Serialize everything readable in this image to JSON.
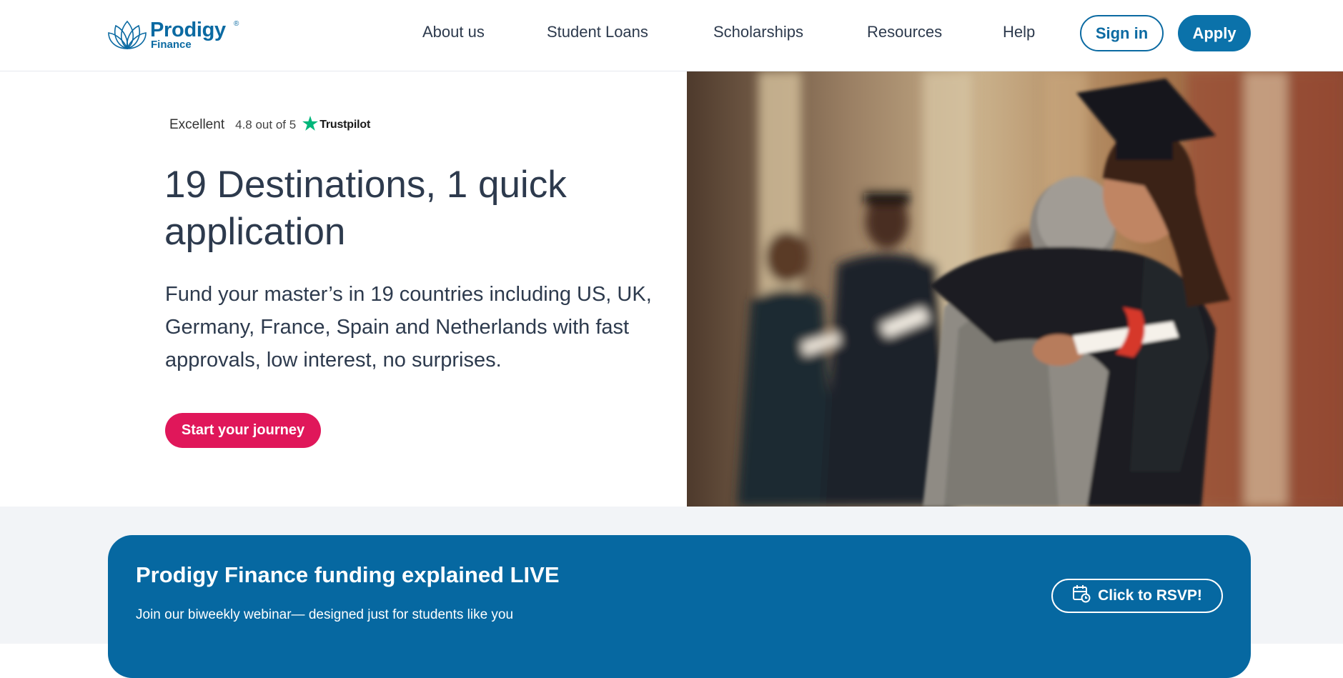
{
  "brand": {
    "name": "Prodigy",
    "registered": "®",
    "sub": "Finance",
    "primary_color": "#0b6aa2",
    "accent_color": "#e0175a"
  },
  "nav": {
    "items": [
      {
        "label": "About us"
      },
      {
        "label": "Student Loans"
      },
      {
        "label": "Scholarships"
      },
      {
        "label": "Resources"
      },
      {
        "label": "Help"
      }
    ],
    "signin_label": "Sign in",
    "apply_label": "Apply"
  },
  "rating": {
    "label": "Excellent",
    "score": "4.8 out of 5",
    "provider": "Trustpilot",
    "icon": "trustpilot-star-icon",
    "icon_color": "#00b67a"
  },
  "hero": {
    "title": "19 Destinations, 1 quick application",
    "text": "Fund your master’s in 19 countries including US, UK, Germany, France, Spain and Netherlands with fast approvals, low interest, no surprises.",
    "cta_label": "Start your journey",
    "image": "graduation-hug-photo"
  },
  "webinar": {
    "title": "Prodigy Finance funding explained LIVE",
    "subtitle": "Join our biweekly webinar— designed just for students like you",
    "cta_label": "Click to RSVP!",
    "cta_icon": "calendar-clock-icon",
    "background": "#0668a1"
  }
}
